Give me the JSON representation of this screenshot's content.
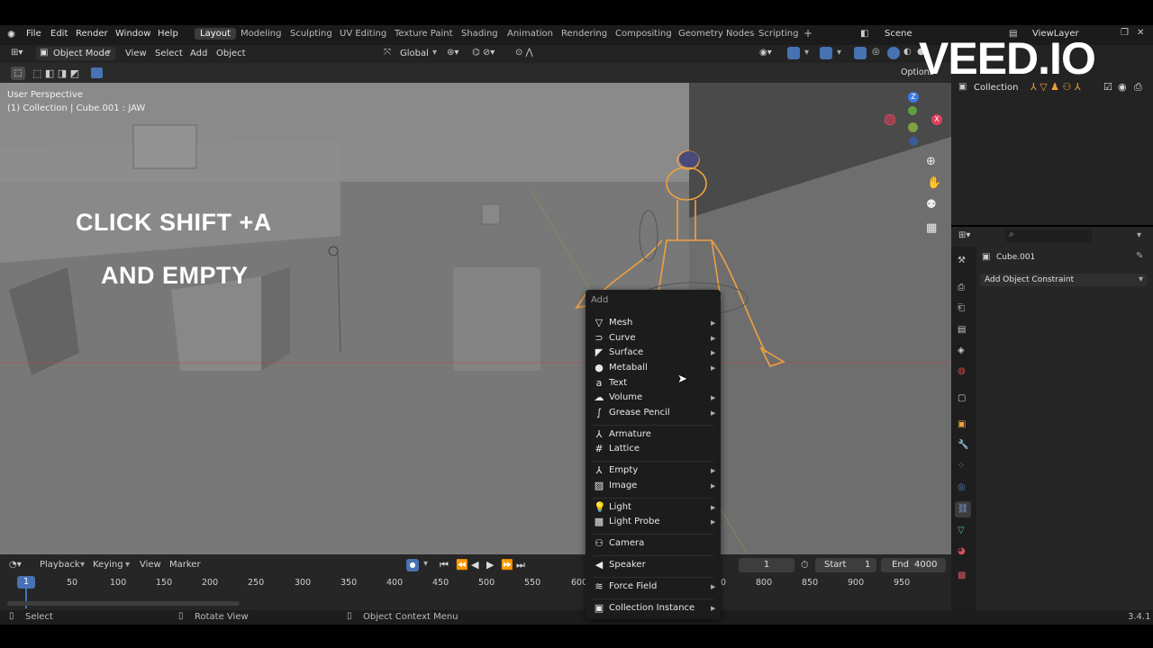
{
  "topbar": {
    "menus": [
      "File",
      "Edit",
      "Render",
      "Window",
      "Help"
    ],
    "workspaces": [
      "Layout",
      "Modeling",
      "Sculpting",
      "UV Editing",
      "Texture Paint",
      "Shading",
      "Animation",
      "Rendering",
      "Compositing",
      "Geometry Nodes",
      "Scripting"
    ],
    "add_workspace": "+",
    "scene": "Scene",
    "view_layer": "ViewLayer"
  },
  "viewport_header": {
    "mode": "Object Mode",
    "menus": [
      "View",
      "Select",
      "Add",
      "Object"
    ],
    "orientation": "Global",
    "options": "Options"
  },
  "viewport": {
    "perspective": "User Perspective",
    "context": "(1) Collection | Cube.001 : JAW",
    "overlay_line1": "CLICK SHIFT +A",
    "overlay_line2": "AND EMPTY",
    "gizmo_z": "Z",
    "gizmo_x": "X"
  },
  "outliner": {
    "collection": "Collection"
  },
  "properties": {
    "object": "Cube.001",
    "add_constraint": "Add Object Constraint",
    "search_placeholder": ""
  },
  "add_menu": {
    "title": "Add",
    "items": [
      {
        "label": "Mesh",
        "submenu": true
      },
      {
        "label": "Curve",
        "submenu": true
      },
      {
        "label": "Surface",
        "submenu": true
      },
      {
        "label": "Metaball",
        "submenu": true
      },
      {
        "label": "Text",
        "submenu": false
      },
      {
        "label": "Volume",
        "submenu": true
      },
      {
        "label": "Grease Pencil",
        "submenu": true
      },
      {
        "label": "Armature",
        "submenu": false
      },
      {
        "label": "Lattice",
        "submenu": false
      },
      {
        "label": "Empty",
        "submenu": true
      },
      {
        "label": "Image",
        "submenu": true
      },
      {
        "label": "Light",
        "submenu": true
      },
      {
        "label": "Light Probe",
        "submenu": true
      },
      {
        "label": "Camera",
        "submenu": false
      },
      {
        "label": "Speaker",
        "submenu": false
      },
      {
        "label": "Force Field",
        "submenu": true
      },
      {
        "label": "Collection Instance",
        "submenu": true
      }
    ]
  },
  "timeline": {
    "menus": [
      "Playback",
      "Keying",
      "View",
      "Marker"
    ],
    "current_frame": "1",
    "start_label": "Start",
    "start": "1",
    "end_label": "End",
    "end": "4000",
    "ticks_left": [
      "1",
      "50",
      "100",
      "150",
      "200",
      "250",
      "300",
      "350",
      "400",
      "450",
      "500",
      "550",
      "600"
    ],
    "ticks_right": [
      "0",
      "800",
      "850",
      "900",
      "950"
    ]
  },
  "statusbar": {
    "select": "Select",
    "rotate": "Rotate View",
    "context_menu": "Object Context Menu",
    "version": "3.4.1"
  },
  "watermark": "VEED.IO",
  "colors": {
    "accent": "#4772b3",
    "selection_orange": "#f0a040",
    "viewport_bg": "#7a7a7a"
  }
}
